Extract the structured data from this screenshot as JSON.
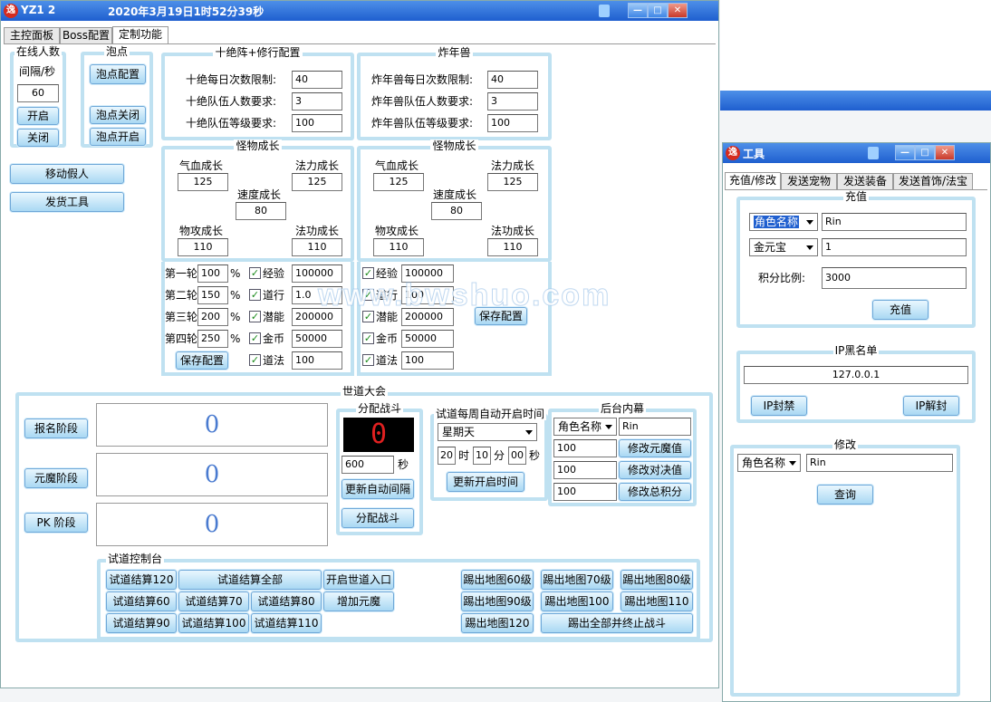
{
  "main_window": {
    "title": "YZ1 2",
    "datetime": "2020年3月19日1时52分39秒",
    "tabs": [
      "主控面板",
      "Boss配置",
      "定制功能"
    ],
    "online": {
      "title": "在线人数",
      "interval_label": "间隔/秒",
      "interval_value": "60",
      "open": "开启",
      "close": "关闭"
    },
    "bubble": {
      "title": "泡点",
      "config": "泡点配置",
      "off": "泡点关闭",
      "on": "泡点开启"
    },
    "move_fake": "移动假人",
    "ship_tool": "发货工具",
    "shijue": {
      "title": "十绝阵+修行配置",
      "rows": [
        {
          "label": "十绝每日次数限制:",
          "value": "40"
        },
        {
          "label": "十绝队伍人数要求:",
          "value": "3"
        },
        {
          "label": "十绝队伍等级要求:",
          "value": "100"
        }
      ]
    },
    "nianshou": {
      "title": "炸年兽",
      "rows": [
        {
          "label": "炸年兽每日次数限制:",
          "value": "40"
        },
        {
          "label": "炸年兽队伍人数要求:",
          "value": "3"
        },
        {
          "label": "炸年兽队伍等级要求:",
          "value": "100"
        }
      ]
    },
    "growth_left": {
      "title": "怪物成长",
      "hp_label": "气血成长",
      "hp": "125",
      "mp_label": "法力成长",
      "mp": "125",
      "spd_label": "速度成长",
      "spd": "80",
      "atk_label": "物攻成长",
      "atk": "110",
      "matk_label": "法功成长",
      "matk": "110"
    },
    "growth_right": {
      "title": "怪物成长",
      "hp_label": "气血成长",
      "hp": "125",
      "mp_label": "法力成长",
      "mp": "125",
      "spd_label": "速度成长",
      "spd": "80",
      "atk_label": "物攻成长",
      "atk": "110",
      "matk_label": "法功成长",
      "matk": "110"
    },
    "rounds_left": {
      "rows": [
        {
          "round": "第一轮",
          "pct": "100",
          "unit": "%",
          "reward": "经验",
          "value": "100000"
        },
        {
          "round": "第二轮",
          "pct": "150",
          "unit": "%",
          "reward": "道行",
          "value": "1.0"
        },
        {
          "round": "第三轮",
          "pct": "200",
          "unit": "%",
          "reward": "潜能",
          "value": "200000"
        },
        {
          "round": "第四轮",
          "pct": "250",
          "unit": "%",
          "reward": "金币",
          "value": "50000"
        },
        {
          "round": "",
          "pct": "",
          "unit": "",
          "reward": "道法",
          "value": "100"
        }
      ],
      "save": "保存配置"
    },
    "rounds_right": {
      "rows": [
        {
          "reward": "经验",
          "value": "100000"
        },
        {
          "reward": "道行",
          "value": "100"
        },
        {
          "reward": "潜能",
          "value": "200000"
        },
        {
          "reward": "金币",
          "value": "50000"
        },
        {
          "reward": "道法",
          "value": "100"
        }
      ],
      "save": "保存配置"
    },
    "watermark": "www.bwshuo.com",
    "shidao": {
      "title": "世道大会",
      "stages": [
        {
          "label": "报名阶段",
          "count": "0"
        },
        {
          "label": "元魔阶段",
          "count": "0"
        },
        {
          "label": "PK 阶段",
          "count": "0"
        }
      ],
      "fight": {
        "title": "分配战斗",
        "display": "0",
        "seconds": "600",
        "sec_label": "秒",
        "update_interval": "更新自动间隔",
        "assign": "分配战斗"
      },
      "weekly": {
        "title": "试道每周自动开启时间",
        "day": "星期天",
        "hour": "20",
        "hour_label": "时",
        "minute": "10",
        "minute_label": "分",
        "second": "00",
        "second_label": "秒",
        "update": "更新开启时间"
      },
      "backstage": {
        "title": "后台内幕",
        "select": "角色名称",
        "name": "Rin",
        "rows": [
          {
            "value": "100",
            "button": "修改元魔值"
          },
          {
            "value": "100",
            "button": "修改对决值"
          },
          {
            "value": "100",
            "button": "修改总积分"
          }
        ]
      }
    },
    "console": {
      "title": "试道控制台",
      "left_buttons": [
        [
          "试道结算120",
          "试道结算全部",
          "开启世道入口"
        ],
        [
          "试道结算60",
          "试道结算70",
          "试道结算80",
          "增加元魔"
        ],
        [
          "试道结算90",
          "试道结算100",
          "试道结算110"
        ]
      ],
      "right_buttons": [
        [
          "踢出地图60级",
          "踢出地图70级",
          "踢出地图80级"
        ],
        [
          "踢出地图90级",
          "踢出地图100",
          "踢出地图110"
        ],
        [
          "踢出地图120",
          "踢出全部并终止战斗"
        ]
      ]
    }
  },
  "tool_window": {
    "title": "工具",
    "tabs": [
      "充值/修改",
      "发送宠物",
      "发送装备",
      "发送首饰/法宝"
    ],
    "recharge": {
      "title": "充值",
      "field1_select": "角色名称",
      "field1_value": "Rin",
      "field2_select": "金元宝",
      "field2_value": "1",
      "ratio_label": "积分比例:",
      "ratio_value": "3000",
      "button": "充值"
    },
    "ip": {
      "title": "IP黑名单",
      "value": "127.0.0.1",
      "ban": "IP封禁",
      "unban": "IP解封"
    },
    "modify": {
      "title": "修改",
      "select": "角色名称",
      "value": "Rin",
      "button": "查询"
    }
  }
}
